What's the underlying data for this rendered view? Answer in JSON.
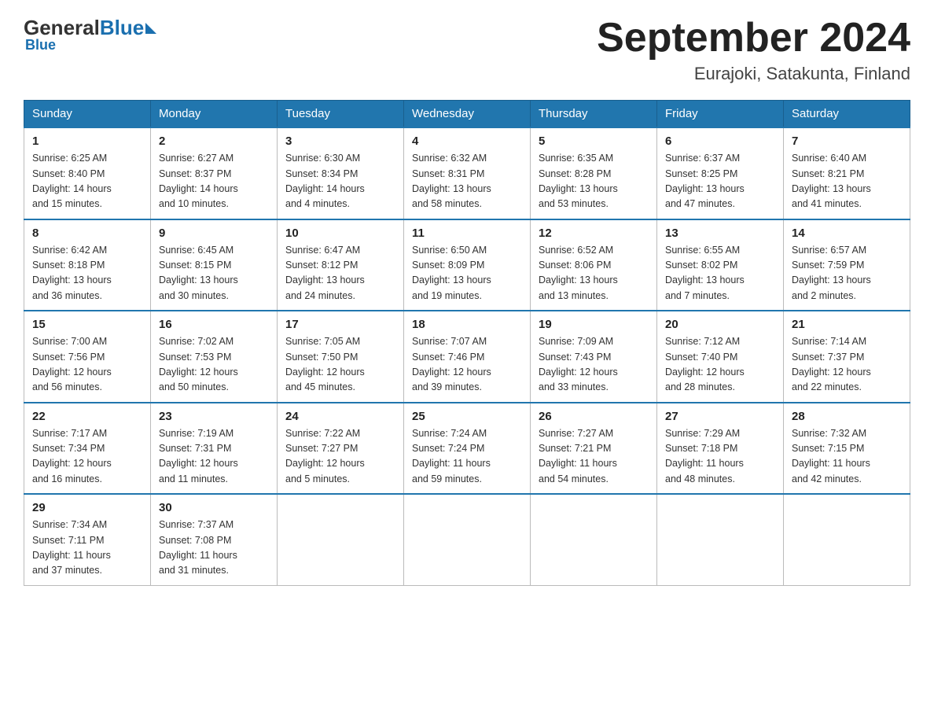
{
  "header": {
    "logo_general": "General",
    "logo_blue": "Blue",
    "month_title": "September 2024",
    "location": "Eurajoki, Satakunta, Finland"
  },
  "weekdays": [
    "Sunday",
    "Monday",
    "Tuesday",
    "Wednesday",
    "Thursday",
    "Friday",
    "Saturday"
  ],
  "weeks": [
    [
      {
        "day": "1",
        "sunrise": "6:25 AM",
        "sunset": "8:40 PM",
        "daylight": "14 hours and 15 minutes."
      },
      {
        "day": "2",
        "sunrise": "6:27 AM",
        "sunset": "8:37 PM",
        "daylight": "14 hours and 10 minutes."
      },
      {
        "day": "3",
        "sunrise": "6:30 AM",
        "sunset": "8:34 PM",
        "daylight": "14 hours and 4 minutes."
      },
      {
        "day": "4",
        "sunrise": "6:32 AM",
        "sunset": "8:31 PM",
        "daylight": "13 hours and 58 minutes."
      },
      {
        "day": "5",
        "sunrise": "6:35 AM",
        "sunset": "8:28 PM",
        "daylight": "13 hours and 53 minutes."
      },
      {
        "day": "6",
        "sunrise": "6:37 AM",
        "sunset": "8:25 PM",
        "daylight": "13 hours and 47 minutes."
      },
      {
        "day": "7",
        "sunrise": "6:40 AM",
        "sunset": "8:21 PM",
        "daylight": "13 hours and 41 minutes."
      }
    ],
    [
      {
        "day": "8",
        "sunrise": "6:42 AM",
        "sunset": "8:18 PM",
        "daylight": "13 hours and 36 minutes."
      },
      {
        "day": "9",
        "sunrise": "6:45 AM",
        "sunset": "8:15 PM",
        "daylight": "13 hours and 30 minutes."
      },
      {
        "day": "10",
        "sunrise": "6:47 AM",
        "sunset": "8:12 PM",
        "daylight": "13 hours and 24 minutes."
      },
      {
        "day": "11",
        "sunrise": "6:50 AM",
        "sunset": "8:09 PM",
        "daylight": "13 hours and 19 minutes."
      },
      {
        "day": "12",
        "sunrise": "6:52 AM",
        "sunset": "8:06 PM",
        "daylight": "13 hours and 13 minutes."
      },
      {
        "day": "13",
        "sunrise": "6:55 AM",
        "sunset": "8:02 PM",
        "daylight": "13 hours and 7 minutes."
      },
      {
        "day": "14",
        "sunrise": "6:57 AM",
        "sunset": "7:59 PM",
        "daylight": "13 hours and 2 minutes."
      }
    ],
    [
      {
        "day": "15",
        "sunrise": "7:00 AM",
        "sunset": "7:56 PM",
        "daylight": "12 hours and 56 minutes."
      },
      {
        "day": "16",
        "sunrise": "7:02 AM",
        "sunset": "7:53 PM",
        "daylight": "12 hours and 50 minutes."
      },
      {
        "day": "17",
        "sunrise": "7:05 AM",
        "sunset": "7:50 PM",
        "daylight": "12 hours and 45 minutes."
      },
      {
        "day": "18",
        "sunrise": "7:07 AM",
        "sunset": "7:46 PM",
        "daylight": "12 hours and 39 minutes."
      },
      {
        "day": "19",
        "sunrise": "7:09 AM",
        "sunset": "7:43 PM",
        "daylight": "12 hours and 33 minutes."
      },
      {
        "day": "20",
        "sunrise": "7:12 AM",
        "sunset": "7:40 PM",
        "daylight": "12 hours and 28 minutes."
      },
      {
        "day": "21",
        "sunrise": "7:14 AM",
        "sunset": "7:37 PM",
        "daylight": "12 hours and 22 minutes."
      }
    ],
    [
      {
        "day": "22",
        "sunrise": "7:17 AM",
        "sunset": "7:34 PM",
        "daylight": "12 hours and 16 minutes."
      },
      {
        "day": "23",
        "sunrise": "7:19 AM",
        "sunset": "7:31 PM",
        "daylight": "12 hours and 11 minutes."
      },
      {
        "day": "24",
        "sunrise": "7:22 AM",
        "sunset": "7:27 PM",
        "daylight": "12 hours and 5 minutes."
      },
      {
        "day": "25",
        "sunrise": "7:24 AM",
        "sunset": "7:24 PM",
        "daylight": "11 hours and 59 minutes."
      },
      {
        "day": "26",
        "sunrise": "7:27 AM",
        "sunset": "7:21 PM",
        "daylight": "11 hours and 54 minutes."
      },
      {
        "day": "27",
        "sunrise": "7:29 AM",
        "sunset": "7:18 PM",
        "daylight": "11 hours and 48 minutes."
      },
      {
        "day": "28",
        "sunrise": "7:32 AM",
        "sunset": "7:15 PM",
        "daylight": "11 hours and 42 minutes."
      }
    ],
    [
      {
        "day": "29",
        "sunrise": "7:34 AM",
        "sunset": "7:11 PM",
        "daylight": "11 hours and 37 minutes."
      },
      {
        "day": "30",
        "sunrise": "7:37 AM",
        "sunset": "7:08 PM",
        "daylight": "11 hours and 31 minutes."
      },
      null,
      null,
      null,
      null,
      null
    ]
  ]
}
